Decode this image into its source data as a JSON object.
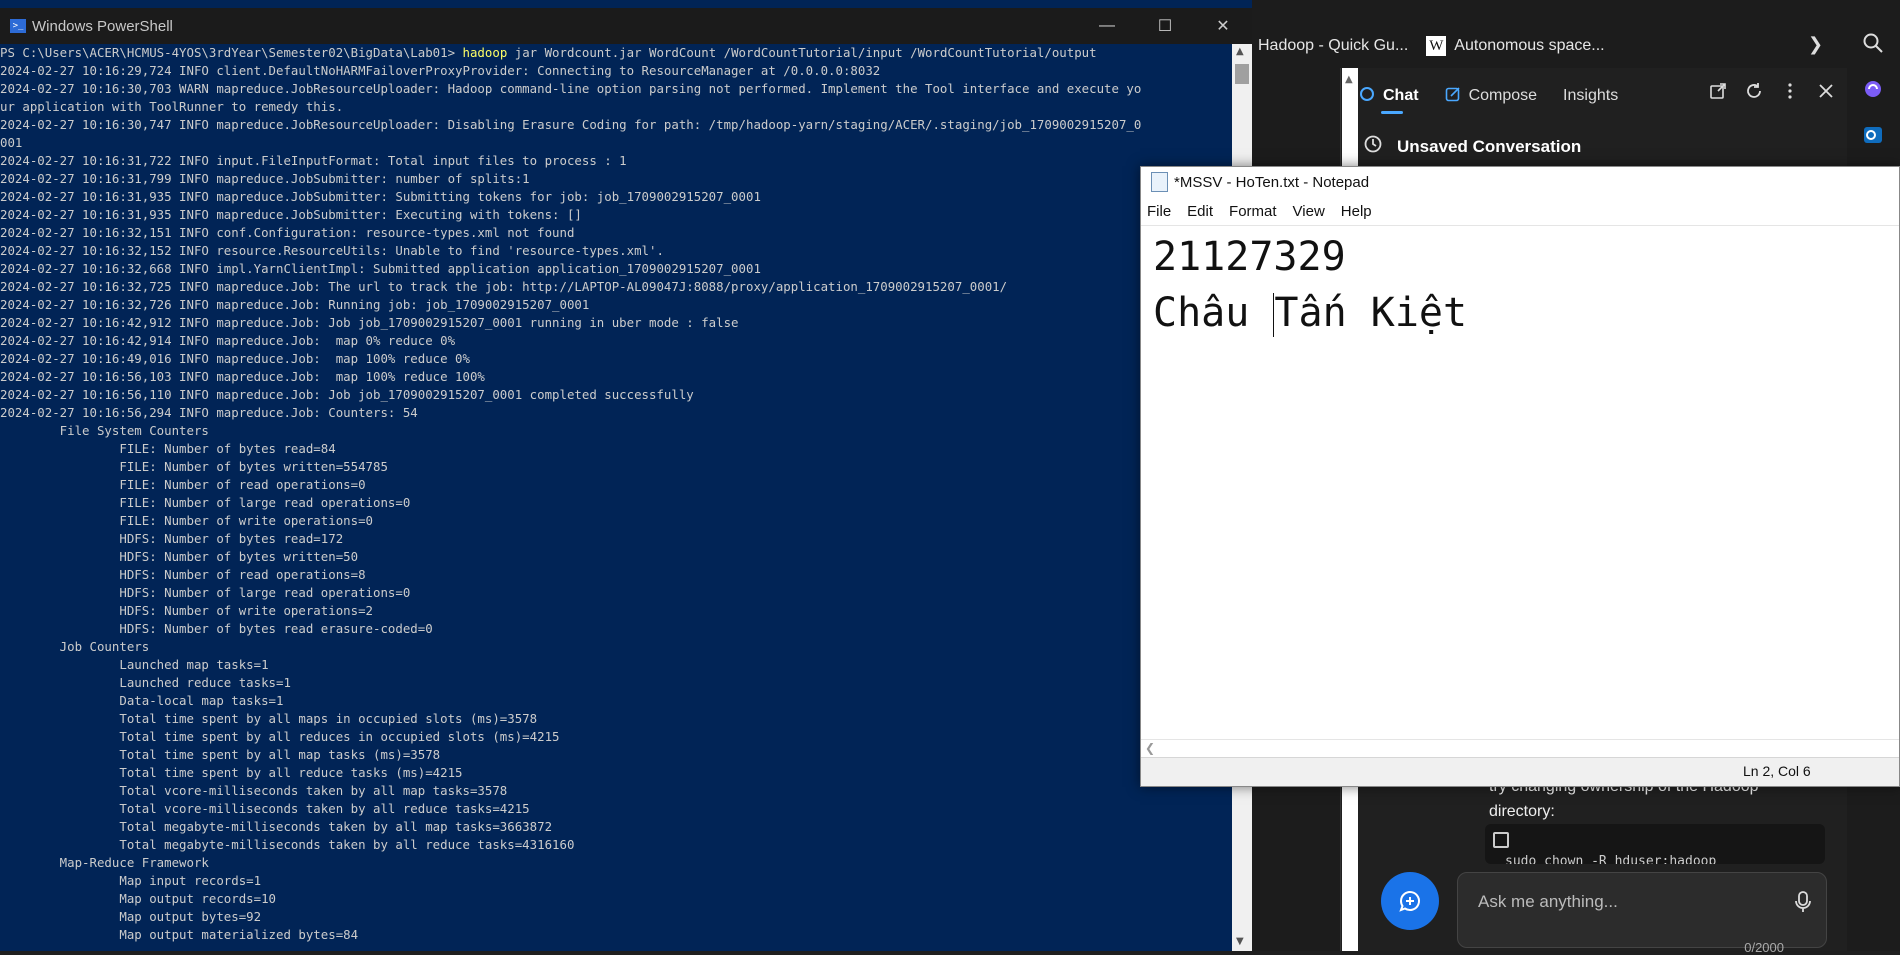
{
  "browser": {
    "bookmarks": [
      {
        "label": "Hadoop - Quick Gu..."
      },
      {
        "label": "Autonomous space..."
      }
    ]
  },
  "copilot": {
    "tabs": [
      {
        "label": "Chat",
        "icon": "copilot-chat-icon",
        "active": true
      },
      {
        "label": "Compose",
        "icon": "compose-icon"
      },
      {
        "label": "Insights"
      }
    ],
    "conversation_title": "Unsaved Conversation",
    "message_text": "try changing ownership of the Hadoop directory:",
    "code_snippet": "sudo chown -R hduser:hadoop",
    "ask_placeholder": "Ask me anything...",
    "char_counter": "0/2000"
  },
  "powershell": {
    "title": "Windows PowerShell",
    "prompt": "PS C:\\Users\\ACER\\HCMUS-4YOS\\3rdYear\\Semester02\\BigData\\Lab01> ",
    "command_word": "hadoop",
    "command_rest": " jar Wordcount.jar WordCount /WordCountTutorial/input /WordCountTutorial/output",
    "lines": [
      "2024-02-27 10:16:29,724 INFO client.DefaultNoHARMFailoverProxyProvider: Connecting to ResourceManager at /0.0.0.0:8032",
      "2024-02-27 10:16:30,703 WARN mapreduce.JobResourceUploader: Hadoop command-line option parsing not performed. Implement the Tool interface and execute yo",
      "ur application with ToolRunner to remedy this.",
      "2024-02-27 10:16:30,747 INFO mapreduce.JobResourceUploader: Disabling Erasure Coding for path: /tmp/hadoop-yarn/staging/ACER/.staging/job_1709002915207_0",
      "001",
      "2024-02-27 10:16:31,722 INFO input.FileInputFormat: Total input files to process : 1",
      "2024-02-27 10:16:31,799 INFO mapreduce.JobSubmitter: number of splits:1",
      "2024-02-27 10:16:31,935 INFO mapreduce.JobSubmitter: Submitting tokens for job: job_1709002915207_0001",
      "2024-02-27 10:16:31,935 INFO mapreduce.JobSubmitter: Executing with tokens: []",
      "2024-02-27 10:16:32,151 INFO conf.Configuration: resource-types.xml not found",
      "2024-02-27 10:16:32,152 INFO resource.ResourceUtils: Unable to find 'resource-types.xml'.",
      "2024-02-27 10:16:32,668 INFO impl.YarnClientImpl: Submitted application application_1709002915207_0001",
      "2024-02-27 10:16:32,725 INFO mapreduce.Job: The url to track the job: http://LAPTOP-AL09047J:8088/proxy/application_1709002915207_0001/",
      "2024-02-27 10:16:32,726 INFO mapreduce.Job: Running job: job_1709002915207_0001",
      "2024-02-27 10:16:42,912 INFO mapreduce.Job: Job job_1709002915207_0001 running in uber mode : false",
      "2024-02-27 10:16:42,914 INFO mapreduce.Job:  map 0% reduce 0%",
      "2024-02-27 10:16:49,016 INFO mapreduce.Job:  map 100% reduce 0%",
      "2024-02-27 10:16:56,103 INFO mapreduce.Job:  map 100% reduce 100%",
      "2024-02-27 10:16:56,110 INFO mapreduce.Job: Job job_1709002915207_0001 completed successfully",
      "2024-02-27 10:16:56,294 INFO mapreduce.Job: Counters: 54",
      "        File System Counters",
      "                FILE: Number of bytes read=84",
      "                FILE: Number of bytes written=554785",
      "                FILE: Number of read operations=0",
      "                FILE: Number of large read operations=0",
      "                FILE: Number of write operations=0",
      "                HDFS: Number of bytes read=172",
      "                HDFS: Number of bytes written=50",
      "                HDFS: Number of read operations=8",
      "                HDFS: Number of large read operations=0",
      "                HDFS: Number of write operations=2",
      "                HDFS: Number of bytes read erasure-coded=0",
      "        Job Counters",
      "                Launched map tasks=1",
      "                Launched reduce tasks=1",
      "                Data-local map tasks=1",
      "                Total time spent by all maps in occupied slots (ms)=3578",
      "                Total time spent by all reduces in occupied slots (ms)=4215",
      "                Total time spent by all map tasks (ms)=3578",
      "                Total time spent by all reduce tasks (ms)=4215",
      "                Total vcore-milliseconds taken by all map tasks=3578",
      "                Total vcore-milliseconds taken by all reduce tasks=4215",
      "                Total megabyte-milliseconds taken by all map tasks=3663872",
      "                Total megabyte-milliseconds taken by all reduce tasks=4316160",
      "        Map-Reduce Framework",
      "                Map input records=1",
      "                Map output records=10",
      "                Map output bytes=92",
      "                Map output materialized bytes=84"
    ]
  },
  "notepad": {
    "title": "*MSSV - HoTen.txt - Notepad",
    "menu": [
      "File",
      "Edit",
      "Format",
      "View",
      "Help"
    ],
    "line1": "21127329",
    "line2_before_caret": "Châu ",
    "line2_after_caret": "Tấn Kiệt",
    "status": "Ln 2, Col 6"
  }
}
